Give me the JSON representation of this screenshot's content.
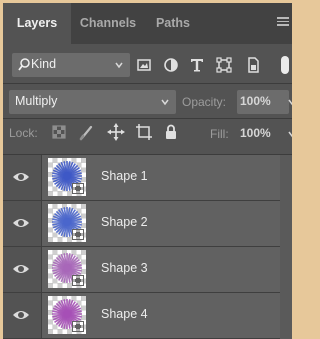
{
  "tabs": [
    {
      "label": "Layers",
      "active": true
    },
    {
      "label": "Channels",
      "active": false
    },
    {
      "label": "Paths",
      "active": false
    }
  ],
  "filter": {
    "kind_label": "Kind",
    "icons": [
      "pixel-filter-icon",
      "adjustment-filter-icon",
      "type-filter-icon",
      "shape-filter-icon",
      "smart-object-filter-icon"
    ]
  },
  "blend": {
    "mode": "Multiply",
    "opacity_label": "Opacity:",
    "opacity_value": "100%"
  },
  "lock": {
    "label": "Lock:",
    "icons": [
      "lock-transparent-icon",
      "lock-image-icon",
      "lock-position-icon",
      "lock-artboard-icon",
      "lock-all-icon"
    ],
    "fill_label": "Fill:",
    "fill_value": "100%"
  },
  "layers": [
    {
      "name": "Shape 1",
      "visible": true,
      "color": "#3e58c6"
    },
    {
      "name": "Shape 2",
      "visible": true,
      "color": "#4a66cc"
    },
    {
      "name": "Shape 3",
      "visible": true,
      "color": "#a867b9"
    },
    {
      "name": "Shape 4",
      "visible": true,
      "color": "#a64fb6"
    }
  ],
  "colors": {
    "panel_bg": "#535353",
    "tab_bar_bg": "#424242",
    "row_bg": "#616161",
    "field_bg": "#6c6c6c",
    "outer_bg": "#e7c89a"
  }
}
